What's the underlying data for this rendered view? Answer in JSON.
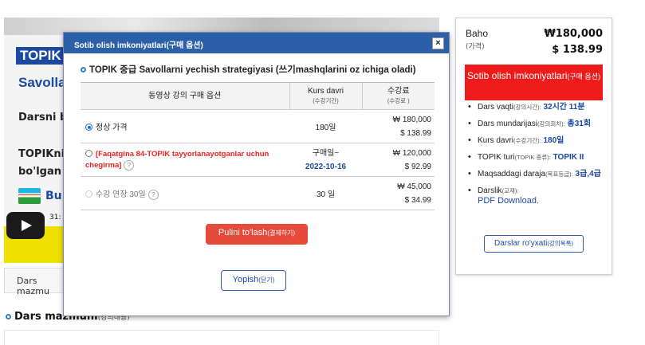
{
  "background": {
    "topik_logo": "TOPIK",
    "heading_partial": "Savolla",
    "line1": "Darsni b",
    "line2": "TOPIKni",
    "line3": "bo'lgan j",
    "brand_partial": "Bu",
    "video_time": "31:",
    "tab_partial": "Dars mazmu",
    "section_title": "Dars mazmuni",
    "section_sub": "(강의내용)"
  },
  "side": {
    "price_label": "Baho",
    "price_sub": "(가격)",
    "price_krw": "₩180,000",
    "price_usd": "$ 138.99",
    "buy_label": "Sotib olish imkoniyatlari",
    "buy_sub": "(구매 옵션)",
    "info": [
      {
        "label": "Dars vaqti",
        "sub": "(강의시간):",
        "value": "32시간 11분"
      },
      {
        "label": "Dars mundarijasi",
        "sub": "(강의회차):",
        "value": "총31회"
      },
      {
        "label": "Kurs davri",
        "sub": "(수강기간):",
        "value": "180일"
      },
      {
        "label": "TOPIK turi",
        "sub": "(TOPIK 종류):",
        "value": "TOPIK II"
      },
      {
        "label": "Maqsaddagi daraja",
        "sub": "(목표등급):",
        "value": "3급,4급"
      },
      {
        "label": "Darslik",
        "sub": "(교재):",
        "value": "PDF Download."
      }
    ],
    "syllabus_label": "Darslar ro'yxati",
    "syllabus_sub": "(강의목록)"
  },
  "modal": {
    "title": "Sotib olish imkoniyatlari(구매 옵션)",
    "close_icon": "×",
    "course_title": "TOPIK 중급 Savollarni yechish strategiyasi (쓰기mashqlarini oz ichiga oladi)",
    "columns": {
      "option": "동영상 강의 구매 옵션",
      "period": "Kurs davri",
      "period_sub": "(수강기간)",
      "fee": "수강료",
      "fee_sub": "(수강료 )"
    },
    "rows": [
      {
        "name": "정상 가격",
        "period": "180일",
        "price_krw": "₩ 180,000",
        "price_usd": "$ 138.99"
      },
      {
        "name": "[Faqatgina 84-TOPIK tayyorlanayotganlar uchun chegirma]",
        "period": "구매일~",
        "period_date": "2022-10-16",
        "price_krw": "₩ 120,000",
        "price_usd": "$ 92.99"
      },
      {
        "name": "수강 연장 30일",
        "period": "30 일",
        "price_krw": "₩ 45,000",
        "price_usd": "$ 34.99"
      }
    ],
    "help_icon": "?",
    "pay_label": "Pulini to'lash",
    "pay_sub": "(결제하기)",
    "close_label": "Yopish",
    "close_sub": "(닫기)"
  },
  "colors": {
    "accent_blue": "#2b5fa8",
    "buy_red": "#ee1b1b",
    "pay_red": "#e64a3b"
  }
}
